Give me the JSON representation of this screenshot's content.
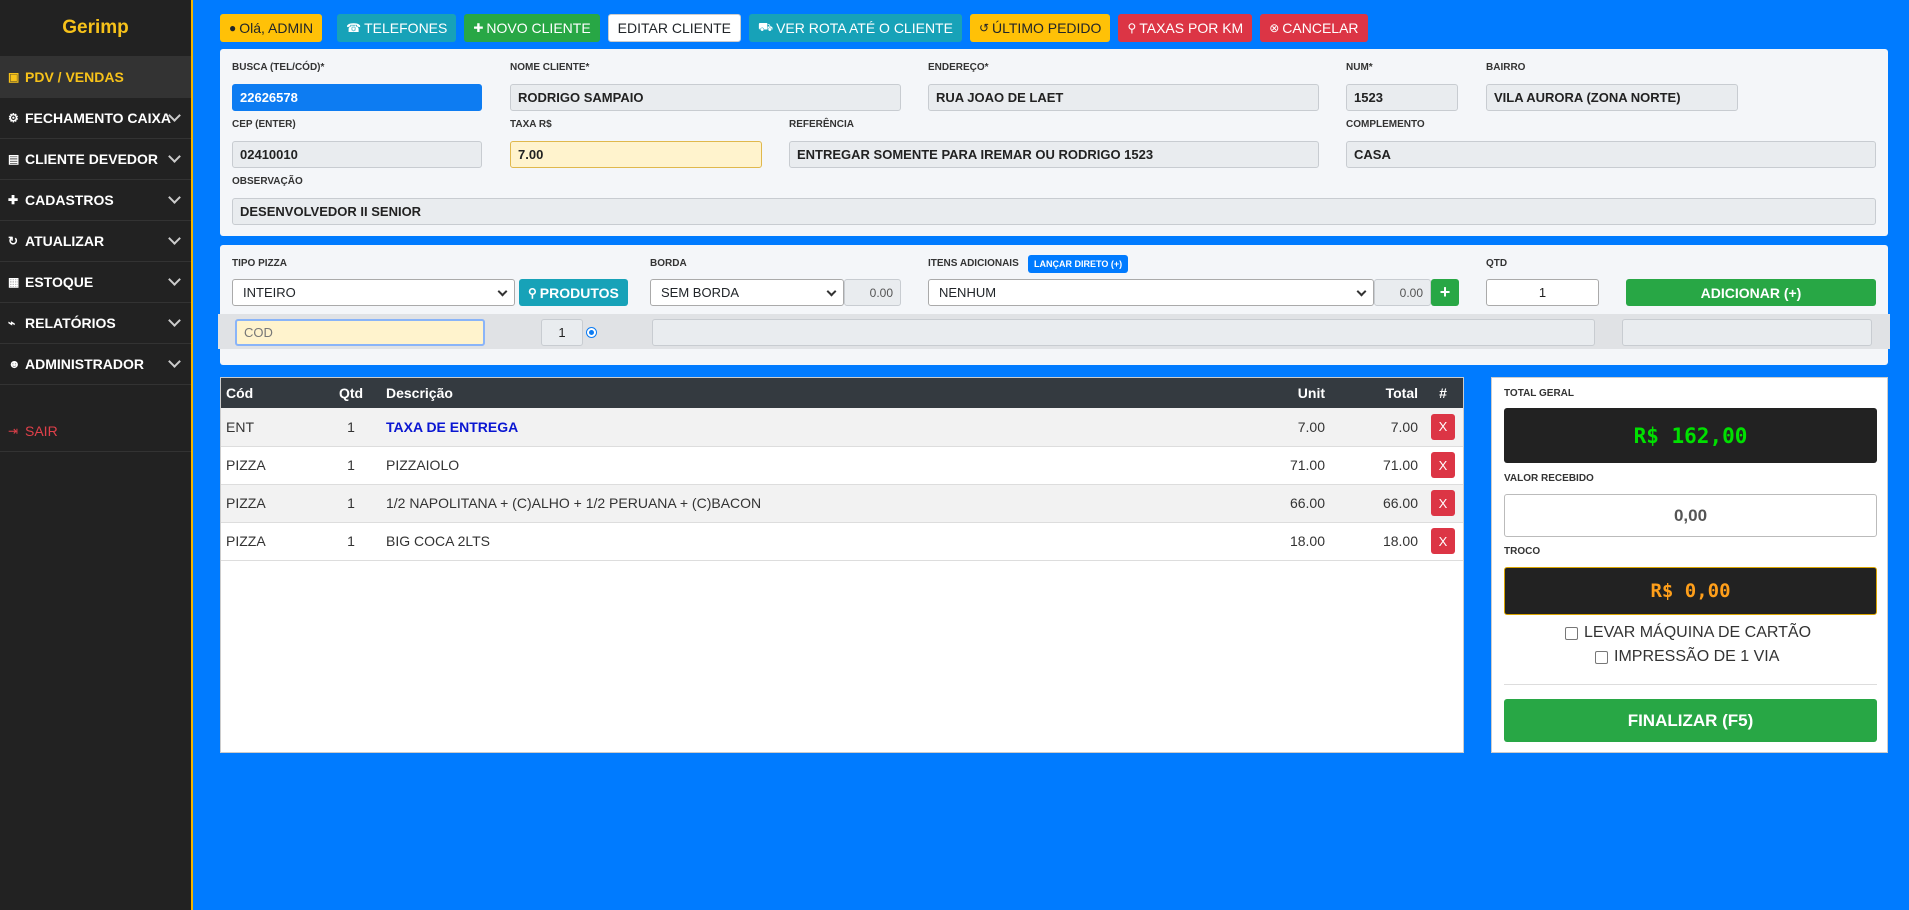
{
  "sidebar": {
    "brand": "Gerimp",
    "items": [
      {
        "label": "PDV / VENDAS",
        "icon": "cash-register-icon"
      },
      {
        "label": "FECHAMENTO CAIXA",
        "icon": "motorcycle-icon"
      },
      {
        "label": "CLIENTE DEVEDOR",
        "icon": "file-invoice-icon"
      },
      {
        "label": "CADASTROS",
        "icon": "user-plus-icon"
      },
      {
        "label": "ATUALIZAR",
        "icon": "sync-icon"
      },
      {
        "label": "ESTOQUE",
        "icon": "boxes-icon"
      },
      {
        "label": "RELATÓRIOS",
        "icon": "chart-line-icon"
      },
      {
        "label": "ADMINISTRADOR",
        "icon": "user-cog-icon"
      }
    ],
    "logout": "SAIR"
  },
  "topbar": {
    "greeting": "Olá, ADMIN",
    "telefones": "TELEFONES",
    "novo_cliente": "NOVO CLIENTE",
    "editar_cliente": "EDITAR CLIENTE",
    "ver_rota": "VER ROTA ATÉ O CLIENTE",
    "ultimo_pedido": "ÚLTIMO PEDIDO",
    "taxas_km": "TAXAS POR KM",
    "cancelar": "CANCELAR"
  },
  "customer": {
    "busca_label": "BUSCA (TEL/CÓD)*",
    "busca_value": "22626578",
    "nome_label": "NOME CLIENTE*",
    "nome_value": "RODRIGO SAMPAIO",
    "endereco_label": "ENDEREÇO*",
    "endereco_value": "RUA JOAO DE LAET",
    "num_label": "NUM*",
    "num_value": "1523",
    "bairro_label": "BAIRRO",
    "bairro_value": "VILA AURORA (ZONA NORTE)",
    "cep_label": "CEP (ENTER)",
    "cep_value": "02410010",
    "taxa_label": "TAXA R$",
    "taxa_value": "7.00",
    "referencia_label": "REFERÊNCIA",
    "referencia_value": "ENTREGAR SOMENTE  PARA IREMAR OU RODRIGO 1523",
    "complemento_label": "COMPLEMENTO",
    "complemento_value": "CASA",
    "observacao_label": "OBSERVAÇÃO",
    "observacao_value": "DESENVOLVEDOR II SENIOR"
  },
  "order_form": {
    "tipo_label": "TIPO PIZZA",
    "tipo_value": "INTEIRO",
    "produtos_button": "PRODUTOS",
    "borda_label": "BORDA",
    "borda_value": "SEM BORDA",
    "borda_price": "0.00",
    "itens_label": "ITENS ADICIONAIS",
    "lancar_button": "LANÇAR DIRETO (+)",
    "itens_value": "NENHUM",
    "itens_price": "0.00",
    "qtd_label": "QTD",
    "qtd_value": "1",
    "adicionar_button": "ADICIONAR (+)",
    "cod_placeholder": "COD",
    "cod_qty": "1"
  },
  "items_table": {
    "headers": {
      "cod": "Cód",
      "qtd": "Qtd",
      "descricao": "Descrição",
      "unit": "Unit",
      "total": "Total",
      "action": "#"
    },
    "rows": [
      {
        "cod": "ENT",
        "qtd": "1",
        "descricao": "TAXA DE ENTREGA",
        "unit": "7.00",
        "total": "7.00",
        "remove": "X"
      },
      {
        "cod": "PIZZA",
        "qtd": "1",
        "descricao": "PIZZAIOLO",
        "unit": "71.00",
        "total": "71.00",
        "remove": "X"
      },
      {
        "cod": "PIZZA",
        "qtd": "1",
        "descricao": "1/2 NAPOLITANA + (C)ALHO + 1/2 PERUANA + (C)BACON",
        "unit": "66.00",
        "total": "66.00",
        "remove": "X"
      },
      {
        "cod": "PIZZA",
        "qtd": "1",
        "descricao": "BIG COCA 2LTS",
        "unit": "18.00",
        "total": "18.00",
        "remove": "X"
      }
    ]
  },
  "totals": {
    "total_label": "TOTAL GERAL",
    "total_value": "R$ 162,00",
    "recebido_label": "VALOR RECEBIDO",
    "recebido_value": "0,00",
    "troco_label": "TROCO",
    "troco_value": "R$ 0,00",
    "maquina_label": "LEVAR MÁQUINA DE CARTÃO",
    "impressao_label": "IMPRESSÃO DE 1 VIA",
    "finalizar_button": "FINALIZAR (F5)"
  },
  "colors": {
    "background": "#007bff",
    "sidebar": "#222222",
    "accent_yellow": "#ffc107",
    "total_green": "#00e000",
    "troco_orange": "#ff9f1a"
  }
}
